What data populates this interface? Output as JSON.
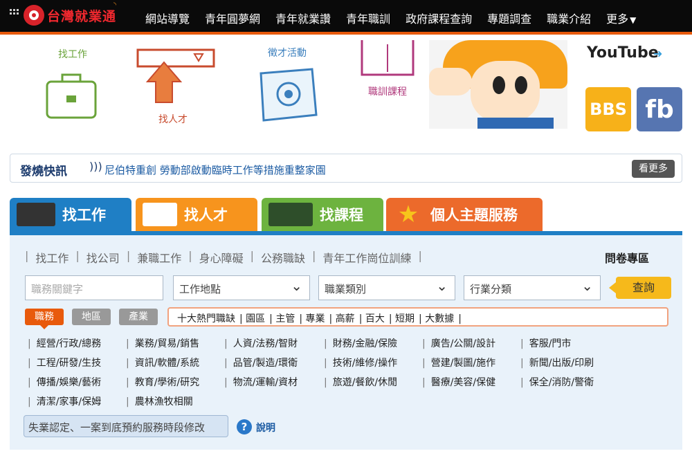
{
  "header": {
    "logo_text": "台灣就業通",
    "nav": [
      "網站導覽",
      "青年圓夢網",
      "青年就業讚",
      "青年職訓",
      "政府課程查詢",
      "專題調查",
      "職業介紹",
      "更多"
    ]
  },
  "banner": {
    "items": [
      "找工作",
      "找人才",
      "徵才活動",
      "職訓課程"
    ],
    "social": {
      "youtube": "YouTube",
      "bbs": "BBS",
      "fb": "fb"
    }
  },
  "news": {
    "title": "發燒快訊",
    "text": "尼伯特重創 勞動部啟動臨時工作等措施重整家園",
    "more": "看更多"
  },
  "tabs": [
    "找工作",
    "找人才",
    "找課程",
    "個人主題服務"
  ],
  "search": {
    "sublinks": [
      "找工作",
      "找公司",
      "兼職工作",
      "身心障礙",
      "公務職缺",
      "青年工作崗位訓練"
    ],
    "survey": "問卷專區",
    "keyword_placeholder": "職務關鍵字",
    "selects": [
      "工作地點",
      "職業類別",
      "行業分類"
    ],
    "query_label": "查詢",
    "categories": [
      "職務",
      "地區",
      "產業"
    ],
    "hot_links": [
      "十大熱門職缺",
      "園區",
      "主管",
      "專業",
      "高薪",
      "百大",
      "短期",
      "大數據"
    ],
    "job_categories": [
      "經營/行政/總務",
      "業務/貿易/銷售",
      "人資/法務/智財",
      "財務/金融/保險",
      "廣告/公關/設計",
      "客服/門市",
      "工程/研發/生技",
      "資訊/軟體/系統",
      "品管/製造/環衛",
      "技術/維修/操作",
      "營建/製圖/施作",
      "新聞/出版/印刷",
      "傳播/娛樂/藝術",
      "教育/學術/研究",
      "物流/運輸/資材",
      "旅遊/餐飲/休閒",
      "醫療/美容/保健",
      "保全/消防/警衛",
      "清潔/家事/保姆",
      "農林漁牧相關"
    ],
    "notice": "失業認定、一案到底預約服務時段修改",
    "help": "說明"
  },
  "colors": {
    "accent": "#e85a0c",
    "tab_blue": "#1f7fc5",
    "tab_orange": "#f7941d",
    "tab_green": "#6db33f",
    "tab_red": "#ec6a2b"
  }
}
